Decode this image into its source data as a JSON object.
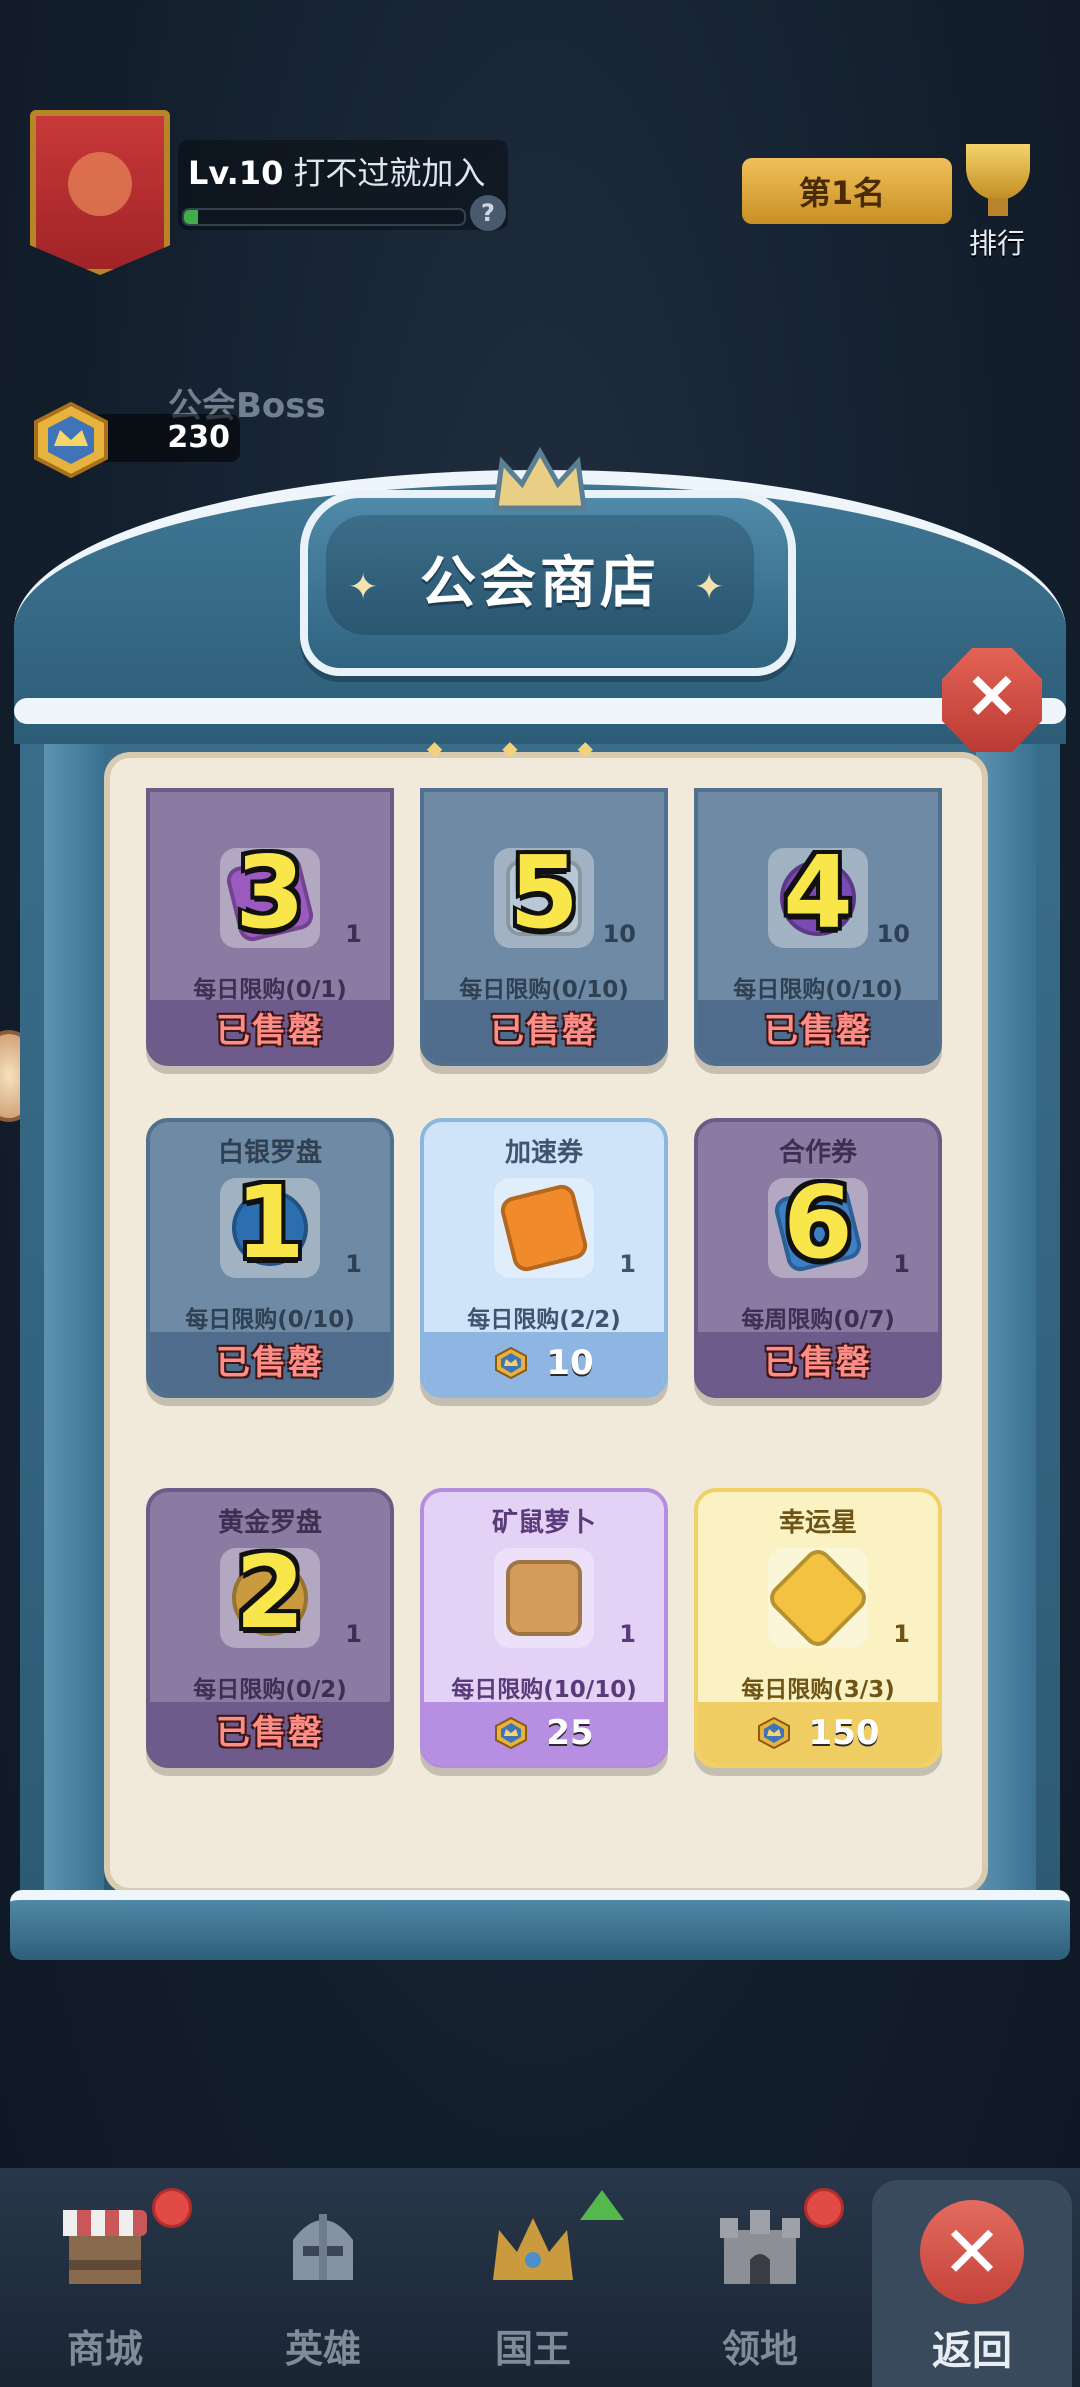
{
  "header": {
    "level": "Lv.10",
    "guild_name": "打不过就加入",
    "xp_fraction": 0.05,
    "help_symbol": "?",
    "rank_value": "第1名",
    "rank_label": "排行",
    "boss_label": "公会Boss",
    "guild_coins": "230"
  },
  "shop": {
    "title": "公会商店",
    "close_symbol": "✕",
    "sold_out_label": "已售罄",
    "items": [
      {
        "name": "",
        "badge": "3",
        "qty": "1",
        "limit": "每日限购(0/1)",
        "status": "sold_out",
        "price": ""
      },
      {
        "name": "",
        "badge": "5",
        "qty": "10",
        "limit": "每日限购(0/10)",
        "status": "sold_out",
        "price": ""
      },
      {
        "name": "",
        "badge": "4",
        "qty": "10",
        "limit": "每日限购(0/10)",
        "status": "sold_out",
        "price": ""
      },
      {
        "name": "白银罗盘",
        "badge": "1",
        "qty": "1",
        "limit": "每日限购(0/10)",
        "status": "sold_out",
        "price": ""
      },
      {
        "name": "加速券",
        "badge": "",
        "qty": "1",
        "limit": "每日限购(2/2)",
        "status": "available",
        "price": "10"
      },
      {
        "name": "合作券",
        "badge": "6",
        "qty": "1",
        "limit": "每周限购(0/7)",
        "status": "sold_out",
        "price": ""
      },
      {
        "name": "黄金罗盘",
        "badge": "2",
        "qty": "1",
        "limit": "每日限购(0/2)",
        "status": "sold_out",
        "price": ""
      },
      {
        "name": "矿鼠萝卜",
        "badge": "",
        "qty": "1",
        "limit": "每日限购(10/10)",
        "status": "available",
        "price": "25"
      },
      {
        "name": "幸运星",
        "badge": "",
        "qty": "1",
        "limit": "每日限购(3/3)",
        "status": "available",
        "price": "150"
      }
    ]
  },
  "nav": {
    "items": [
      {
        "label": "商城",
        "icon": "shop-icon"
      },
      {
        "label": "英雄",
        "icon": "knight-helmet-icon"
      },
      {
        "label": "国王",
        "icon": "crown-icon"
      },
      {
        "label": "领地",
        "icon": "castle-icon"
      }
    ],
    "return_label": "返回",
    "return_symbol": "✕"
  },
  "colors": {
    "accent_red": "#e24a45",
    "sold_out_text": "#ff8d86",
    "badge_yellow": "#f8e64a",
    "panel_blue": "#3a6e8b"
  }
}
